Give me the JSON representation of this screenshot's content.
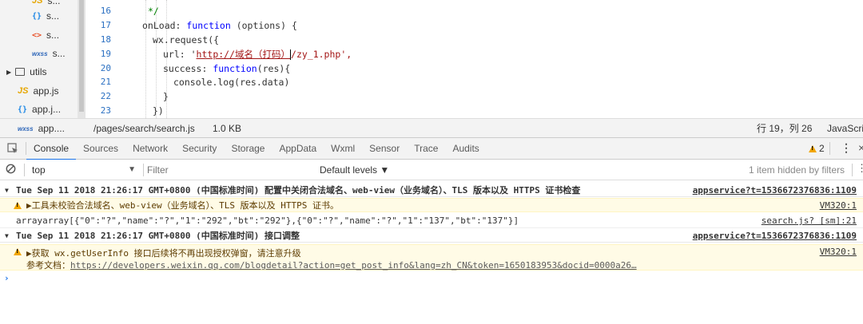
{
  "sidebar": {
    "items": [
      {
        "icon": "JS",
        "label": "s..."
      },
      {
        "icon": "{ }",
        "label": "s..."
      },
      {
        "icon": "<>",
        "label": "s..."
      },
      {
        "icon": "wxss",
        "label": "s..."
      },
      {
        "icon": "folder",
        "label": "utils"
      },
      {
        "icon": "JS",
        "label": "app.js"
      },
      {
        "icon": "{ }",
        "label": "app.j..."
      },
      {
        "icon": "wxss",
        "label": "app...."
      }
    ]
  },
  "editor": {
    "lines": [
      {
        "num": "16",
        "text": "*/"
      },
      {
        "num": "17",
        "text": "onLoad: function (options) {"
      },
      {
        "num": "18",
        "text": "wx.request({"
      },
      {
        "num": "19",
        "url_prefix": "url: '",
        "url_text": "http://域名（打码）",
        "url_rest": "/zy_1.php",
        "url_suffix": "',"
      },
      {
        "num": "20",
        "text": "success: function(res){"
      },
      {
        "num": "21",
        "text": "console.log(res.data)"
      },
      {
        "num": "22",
        "text": "}"
      },
      {
        "num": "23",
        "text": "})"
      }
    ]
  },
  "statusbar": {
    "path": "/pages/search/search.js",
    "size": "1.0 KB",
    "position": "行 19，列 26",
    "language": "JavaScri"
  },
  "devtools": {
    "tabs": [
      "Console",
      "Sources",
      "Network",
      "Security",
      "Storage",
      "AppData",
      "Wxml",
      "Sensor",
      "Trace",
      "Audits"
    ],
    "active_tab": "Console",
    "warning_count": "2"
  },
  "console_toolbar": {
    "context": "top",
    "filter_placeholder": "Filter",
    "levels": "Default levels ▼",
    "hidden_info": "1 item hidden by filters"
  },
  "messages": [
    {
      "type": "group",
      "text": "Tue Sep 11 2018 21:26:17 GMT+0800 (中国标准时间) 配置中关闭合法域名、web-view（业务域名）、TLS 版本以及 HTTPS 证书检查",
      "source": "appservice?t=1536672376836:1109"
    },
    {
      "type": "warn",
      "text": "▶工具未校验合法域名、web-view（业务域名）、TLS 版本以及 HTTPS 证书。",
      "source": "VM320:1"
    },
    {
      "type": "log",
      "text": "arrayarray[{\"0\":\"?\",\"name\":\"?\",\"1\":\"292\",\"bt\":\"292\"},{\"0\":\"?\",\"name\":\"?\",\"1\":\"137\",\"bt\":\"137\"}]",
      "source": "search.js? [sm]:21"
    },
    {
      "type": "group",
      "text": "Tue Sep 11 2018 21:26:17 GMT+0800 (中国标准时间) 接口调整",
      "source": "appservice?t=1536672376836:1109"
    },
    {
      "type": "warn",
      "text": "▶获取 wx.getUserInfo 接口后续将不再出现授权弹窗，请注意升级",
      "line2_label": "参考文档：",
      "line2_link": "https://developers.weixin.qq.com/blogdetail?action=get_post_info&lang=zh_CN&token=1650183953&docid=0000a26…",
      "source": "VM320:1"
    }
  ],
  "prompt": "›"
}
